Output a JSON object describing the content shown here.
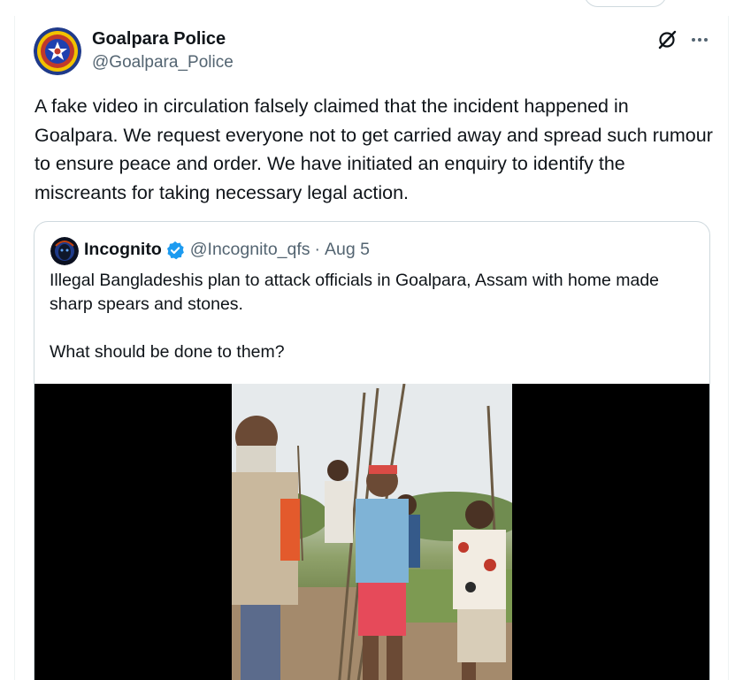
{
  "author": {
    "display_name": "Goalpara Police",
    "handle": "@Goalpara_Police",
    "avatar_text_top": "ASSAM",
    "avatar_text_right": "POLICE"
  },
  "tweet": {
    "text": "A fake video in circulation falsely claimed that the incident happened in Goalpara. We request everyone not to get carried away and spread such rumour to ensure peace and order. We have initiated an enquiry to identify the miscreants for taking necessary legal action."
  },
  "quote": {
    "display_name": "Incognito",
    "handle": "@Incognito_qfs",
    "separator": "·",
    "date": "Aug 5",
    "paragraphs": [
      "Illegal Bangladeshis plan to attack officials in Goalpara, Assam with home made sharp spears and stones.",
      "What should be done to them?"
    ]
  },
  "icons": {
    "grok": "grok-slash-icon",
    "more": "more-horizontal-icon",
    "verified": "verified-badge-icon"
  },
  "colors": {
    "text_primary": "#0f1419",
    "text_secondary": "#536471",
    "verified_blue": "#1d9bf0",
    "border": "#cfd9de"
  }
}
